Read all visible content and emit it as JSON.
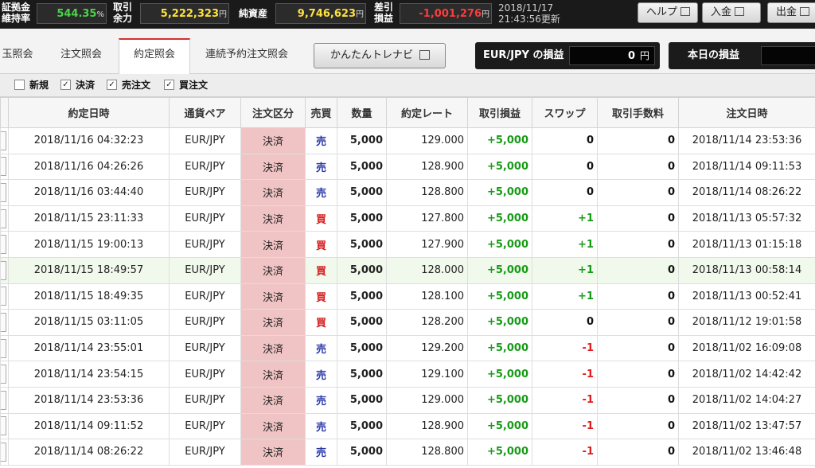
{
  "topbar": {
    "margin_label_1": "証拠金",
    "margin_label_2": "維持率",
    "margin_value": "544.35",
    "margin_unit": "%",
    "avail_label_1": "取引",
    "avail_label_2": "余力",
    "avail_value": "5,222,323",
    "avail_unit": "円",
    "net_label": "純資産",
    "net_value": "9,746,623",
    "net_unit": "円",
    "diff_label_1": "差引",
    "diff_label_2": "損益",
    "diff_value": "-1,001,276",
    "diff_unit": "円",
    "date": "2018/11/17",
    "updated": "21:43:56更新",
    "help_label": "ヘルプ",
    "deposit_label": "入金",
    "withdraw_label": "出金"
  },
  "tabs": [
    {
      "label": "玉照会"
    },
    {
      "label": "注文照会"
    },
    {
      "label": "約定照会",
      "active": true
    },
    {
      "label": "連続予約注文照会"
    }
  ],
  "navi_label": "かんたんトレナビ",
  "pair_pl": {
    "label": "EUR/JPY の損益",
    "value": "0",
    "unit": "円"
  },
  "today_pl": {
    "label": "本日の損益"
  },
  "filters": [
    {
      "label": "新規",
      "checked": false
    },
    {
      "label": "決済",
      "checked": true
    },
    {
      "label": "売注文",
      "checked": true
    },
    {
      "label": "買注文",
      "checked": true
    }
  ],
  "columns": {
    "sel": "",
    "date": "約定日時",
    "pair": "通貨ペア",
    "kind": "注文区分",
    "side": "売買",
    "qty": "数量",
    "rate": "約定レート",
    "pl": "取引損益",
    "swap": "スワップ",
    "fee": "取引手数料",
    "odate": "注文日時"
  },
  "rows": [
    {
      "date": "2018/11/16 04:32:23",
      "pair": "EUR/JPY",
      "kind": "決済",
      "side": "売",
      "qty": "5,000",
      "rate": "129.000",
      "pl": "+5,000",
      "swap": "0",
      "fee": "0",
      "odate": "2018/11/14 23:53:36"
    },
    {
      "date": "2018/11/16 04:26:26",
      "pair": "EUR/JPY",
      "kind": "決済",
      "side": "売",
      "qty": "5,000",
      "rate": "128.900",
      "pl": "+5,000",
      "swap": "0",
      "fee": "0",
      "odate": "2018/11/14 09:11:53"
    },
    {
      "date": "2018/11/16 03:44:40",
      "pair": "EUR/JPY",
      "kind": "決済",
      "side": "売",
      "qty": "5,000",
      "rate": "128.800",
      "pl": "+5,000",
      "swap": "0",
      "fee": "0",
      "odate": "2018/11/14 08:26:22"
    },
    {
      "date": "2018/11/15 23:11:33",
      "pair": "EUR/JPY",
      "kind": "決済",
      "side": "買",
      "qty": "5,000",
      "rate": "127.800",
      "pl": "+5,000",
      "swap": "+1",
      "fee": "0",
      "odate": "2018/11/13 05:57:32"
    },
    {
      "date": "2018/11/15 19:00:13",
      "pair": "EUR/JPY",
      "kind": "決済",
      "side": "買",
      "qty": "5,000",
      "rate": "127.900",
      "pl": "+5,000",
      "swap": "+1",
      "fee": "0",
      "odate": "2018/11/13 01:15:18"
    },
    {
      "date": "2018/11/15 18:49:57",
      "pair": "EUR/JPY",
      "kind": "決済",
      "side": "買",
      "qty": "5,000",
      "rate": "128.000",
      "pl": "+5,000",
      "swap": "+1",
      "fee": "0",
      "odate": "2018/11/13 00:58:14",
      "highlight": true
    },
    {
      "date": "2018/11/15 18:49:35",
      "pair": "EUR/JPY",
      "kind": "決済",
      "side": "買",
      "qty": "5,000",
      "rate": "128.100",
      "pl": "+5,000",
      "swap": "+1",
      "fee": "0",
      "odate": "2018/11/13 00:52:41"
    },
    {
      "date": "2018/11/15 03:11:05",
      "pair": "EUR/JPY",
      "kind": "決済",
      "side": "買",
      "qty": "5,000",
      "rate": "128.200",
      "pl": "+5,000",
      "swap": "0",
      "fee": "0",
      "odate": "2018/11/12 19:01:58"
    },
    {
      "date": "2018/11/14 23:55:01",
      "pair": "EUR/JPY",
      "kind": "決済",
      "side": "売",
      "qty": "5,000",
      "rate": "129.200",
      "pl": "+5,000",
      "swap": "-1",
      "fee": "0",
      "odate": "2018/11/02 16:09:08"
    },
    {
      "date": "2018/11/14 23:54:15",
      "pair": "EUR/JPY",
      "kind": "決済",
      "side": "売",
      "qty": "5,000",
      "rate": "129.100",
      "pl": "+5,000",
      "swap": "-1",
      "fee": "0",
      "odate": "2018/11/02 14:42:42"
    },
    {
      "date": "2018/11/14 23:53:36",
      "pair": "EUR/JPY",
      "kind": "決済",
      "side": "売",
      "qty": "5,000",
      "rate": "129.000",
      "pl": "+5,000",
      "swap": "-1",
      "fee": "0",
      "odate": "2018/11/02 14:04:27"
    },
    {
      "date": "2018/11/14 09:11:52",
      "pair": "EUR/JPY",
      "kind": "決済",
      "side": "売",
      "qty": "5,000",
      "rate": "128.900",
      "pl": "+5,000",
      "swap": "-1",
      "fee": "0",
      "odate": "2018/11/02 13:47:57"
    },
    {
      "date": "2018/11/14 08:26:22",
      "pair": "EUR/JPY",
      "kind": "決済",
      "side": "売",
      "qty": "5,000",
      "rate": "128.800",
      "pl": "+5,000",
      "swap": "-1",
      "fee": "0",
      "odate": "2018/11/02 13:46:48"
    }
  ],
  "colors": {
    "positive": "#169b16",
    "negative": "#e01b1b",
    "sell": "#2c3aa8",
    "buy": "#d61f1f",
    "settle_bg": "#f0c4c4",
    "highlight_row": "#f1f9ec",
    "active_tab_border": "#d62e2e"
  }
}
